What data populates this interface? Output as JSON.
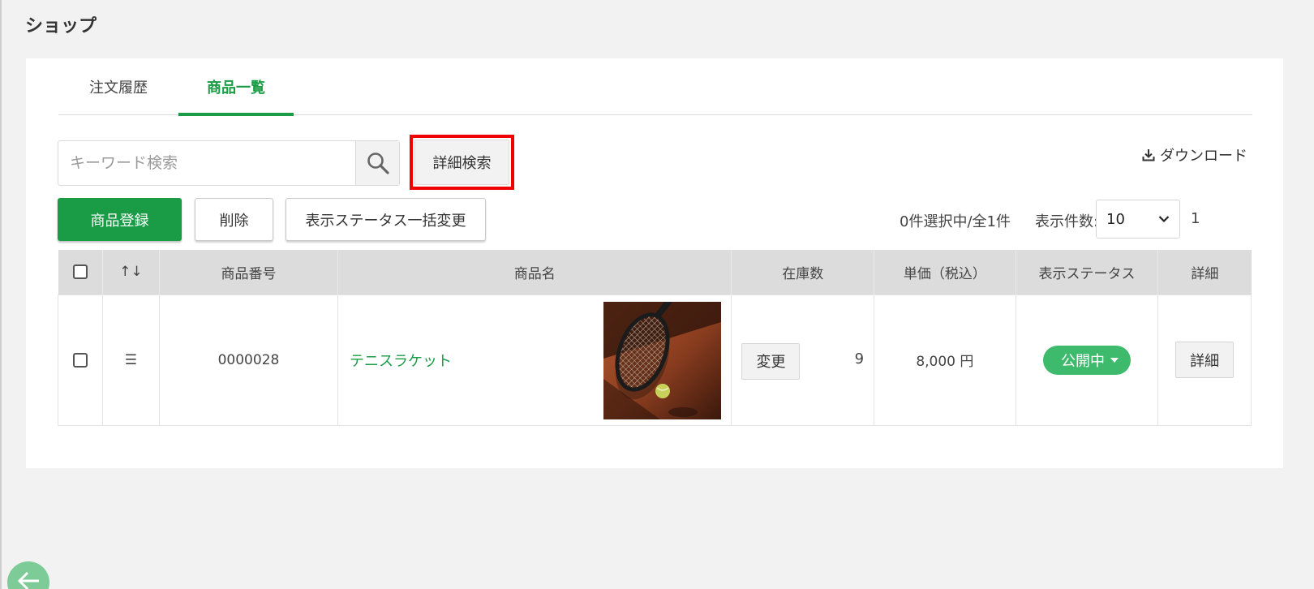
{
  "page": {
    "title": "ショップ"
  },
  "tabs": [
    {
      "label": "注文履歴"
    },
    {
      "label": "商品一覧"
    }
  ],
  "toolbar": {
    "search_placeholder": "キーワード検索",
    "advanced_search_label": "詳細検索",
    "download_label": "ダウンロード",
    "register_label": "商品登録",
    "delete_label": "削除",
    "bulk_status_label": "表示ステータス一括変更",
    "selection_info": "0件選択中/全1件",
    "per_page_label": "表示件数:",
    "per_page_value": "10",
    "page_number": "1"
  },
  "table": {
    "headers": {
      "sort": "↑↓",
      "product_no": "商品番号",
      "product_name": "商品名",
      "stock": "在庫数",
      "price": "単価（税込）",
      "status": "表示ステータス",
      "detail": "詳細"
    },
    "rows": [
      {
        "handle": "☰",
        "product_no": "0000028",
        "product_name": "テニスラケット",
        "change_label": "変更",
        "stock": "9",
        "price": "8,000 円",
        "status": "公開中",
        "detail_label": "詳細"
      }
    ]
  },
  "colors": {
    "accent": "#1a9c46",
    "status_public": "#3dba6b",
    "highlight_box": "#ee0000"
  }
}
